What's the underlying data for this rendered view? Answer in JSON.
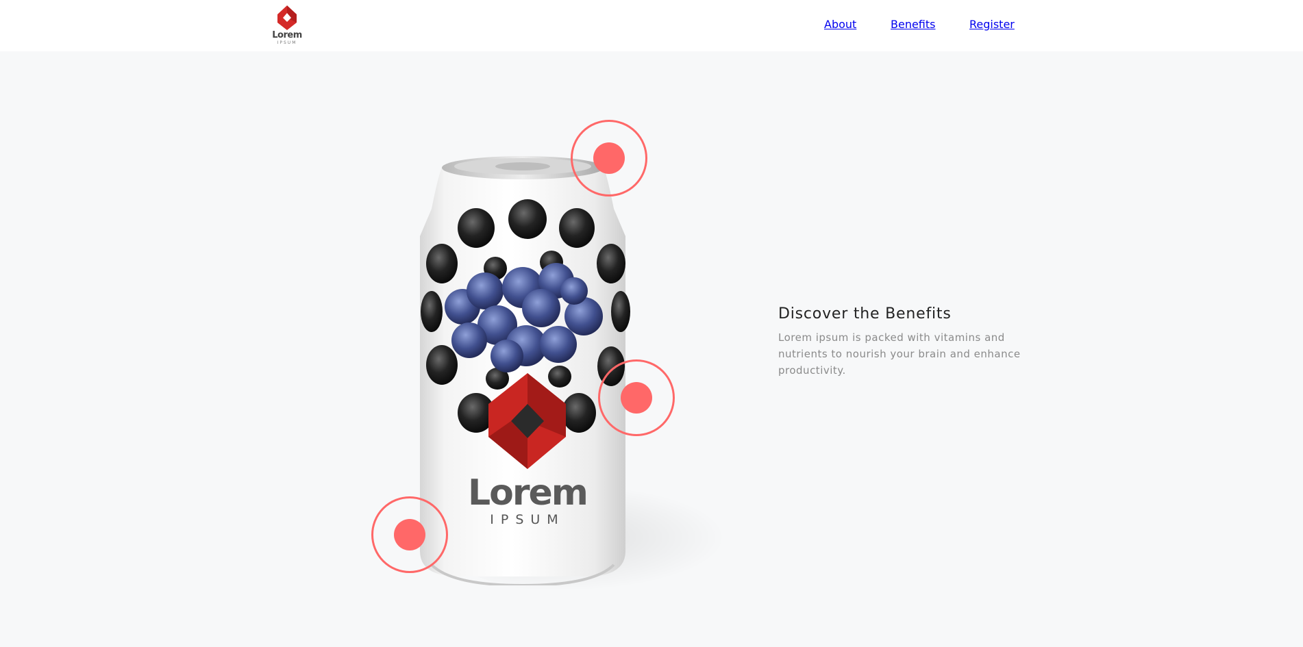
{
  "header": {
    "logo": {
      "wordmark": "Lorem",
      "tagline": "IPSUM",
      "icon": "red-diamond-logo-icon",
      "color": "#d42a28"
    },
    "nav": [
      {
        "label": "About"
      },
      {
        "label": "Benefits"
      },
      {
        "label": "Register"
      }
    ]
  },
  "product": {
    "can_label": {
      "brand": "Lorem",
      "sub": "IPSUM"
    },
    "image": "blueberry-soda-can"
  },
  "benefits": {
    "title": "Discover the Benefits",
    "body": "Lorem ipsum is packed with vitamins and nutrients to nourish your brain and enhance productivity."
  },
  "colors": {
    "accent": "#ff6868",
    "background": "#f7f8f9",
    "header": "#ffffff"
  }
}
